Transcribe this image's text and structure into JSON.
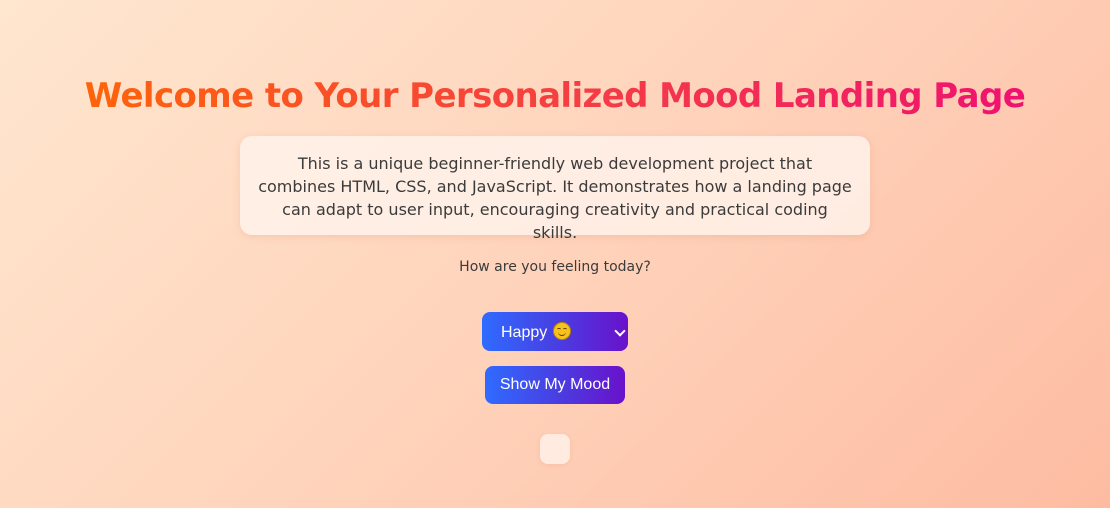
{
  "header": {
    "title": "Welcome to Your Personalized Mood Landing Page"
  },
  "description": {
    "text": "This is a unique beginner-friendly web development project that combines HTML, CSS, and JavaScript. It demonstrates how a landing page can adapt to user input, encouraging creativity and practical coding skills."
  },
  "mood_form": {
    "prompt": "How are you feeling today?",
    "select": {
      "selected_label": "Happy",
      "selected_icon": "smiling-face-icon"
    },
    "submit_label": "Show My Mood"
  },
  "result": {
    "text": ""
  },
  "colors": {
    "title_gradient": [
      "#ff6a00",
      "#f43b47",
      "#ee0979"
    ],
    "button_gradient": [
      "#2f6bff",
      "#6a11cb"
    ],
    "background_gradient": [
      "#ffe6cf",
      "#fdbca2"
    ]
  }
}
